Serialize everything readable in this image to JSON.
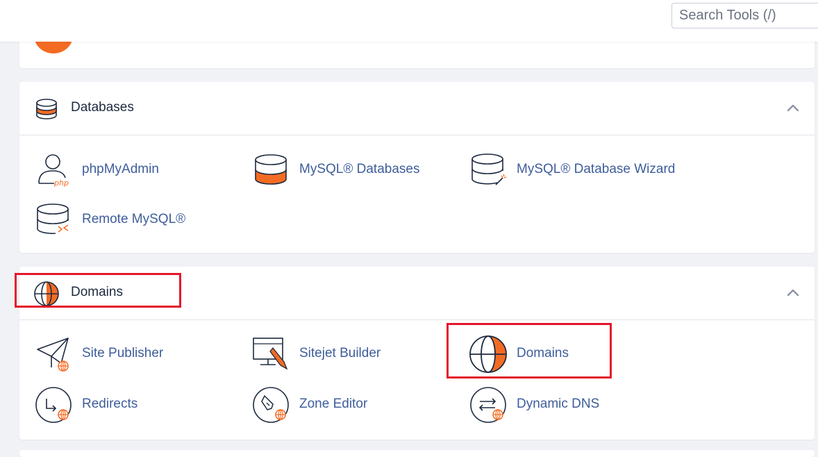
{
  "search": {
    "placeholder": "Search Tools (/)"
  },
  "sections": {
    "databases": {
      "title": "Databases",
      "tools": [
        {
          "label": "phpMyAdmin",
          "icon": "phpmyadmin-icon"
        },
        {
          "label": "MySQL® Databases",
          "icon": "mysql-databases-icon"
        },
        {
          "label": "MySQL® Database Wizard",
          "icon": "mysql-wizard-icon"
        },
        {
          "label": "Remote MySQL®",
          "icon": "remote-mysql-icon"
        }
      ]
    },
    "domains": {
      "title": "Domains",
      "tools": [
        {
          "label": "Site Publisher",
          "icon": "site-publisher-icon"
        },
        {
          "label": "Sitejet Builder",
          "icon": "sitejet-builder-icon"
        },
        {
          "label": "Domains",
          "icon": "domains-globe-icon"
        },
        {
          "label": "Redirects",
          "icon": "redirects-icon"
        },
        {
          "label": "Zone Editor",
          "icon": "zone-editor-icon"
        },
        {
          "label": "Dynamic DNS",
          "icon": "dynamic-dns-icon"
        }
      ]
    }
  },
  "colors": {
    "accent": "#f36b23",
    "link": "#3e5d9b",
    "highlight": "#e4172b",
    "text": "#1d2a3f"
  }
}
